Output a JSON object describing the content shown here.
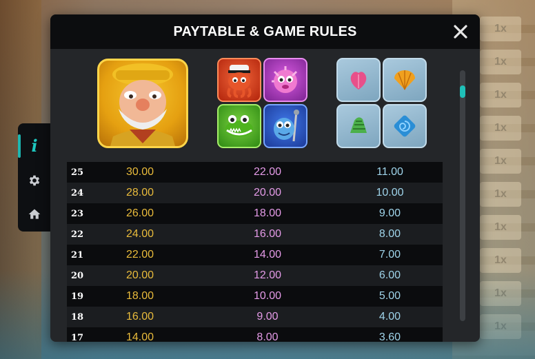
{
  "background": {
    "reel_tiles": [
      "1x",
      "1x",
      "1x",
      "1x",
      "1x",
      "1x",
      "1x",
      "1x",
      "1x",
      "1x"
    ]
  },
  "side_menu": {
    "items": [
      {
        "name": "info",
        "icon": "info-icon",
        "active": true
      },
      {
        "name": "settings",
        "icon": "gear-icon",
        "active": false
      },
      {
        "name": "home",
        "icon": "home-icon",
        "active": false
      }
    ],
    "accent_color": "#1db6b0"
  },
  "modal": {
    "title": "PAYTABLE & GAME RULES",
    "close_icon": "close-icon",
    "symbols": {
      "big": "fisherman-symbol",
      "creatures": [
        "octopus-captain-symbol",
        "pufferfish-symbol",
        "crocodile-symbol",
        "fish-warrior-symbol"
      ],
      "shells": [
        "pink-shell-symbol",
        "orange-shell-symbol",
        "green-shell-symbol",
        "blue-shell-symbol"
      ]
    },
    "paytable": {
      "colors": {
        "col1": "#e9bb3b",
        "col2": "#e59be8",
        "col3": "#9fd4ea"
      },
      "rows": [
        {
          "count": "25",
          "col1": "30.00",
          "col2": "22.00",
          "col3": "11.00"
        },
        {
          "count": "24",
          "col1": "28.00",
          "col2": "20.00",
          "col3": "10.00"
        },
        {
          "count": "23",
          "col1": "26.00",
          "col2": "18.00",
          "col3": "9.00"
        },
        {
          "count": "22",
          "col1": "24.00",
          "col2": "16.00",
          "col3": "8.00"
        },
        {
          "count": "21",
          "col1": "22.00",
          "col2": "14.00",
          "col3": "7.00"
        },
        {
          "count": "20",
          "col1": "20.00",
          "col2": "12.00",
          "col3": "6.00"
        },
        {
          "count": "19",
          "col1": "18.00",
          "col2": "10.00",
          "col3": "5.00"
        },
        {
          "count": "18",
          "col1": "16.00",
          "col2": "9.00",
          "col3": "4.00"
        },
        {
          "count": "17",
          "col1": "14.00",
          "col2": "8.00",
          "col3": "3.60"
        }
      ]
    },
    "scroll_position": 0.05
  }
}
